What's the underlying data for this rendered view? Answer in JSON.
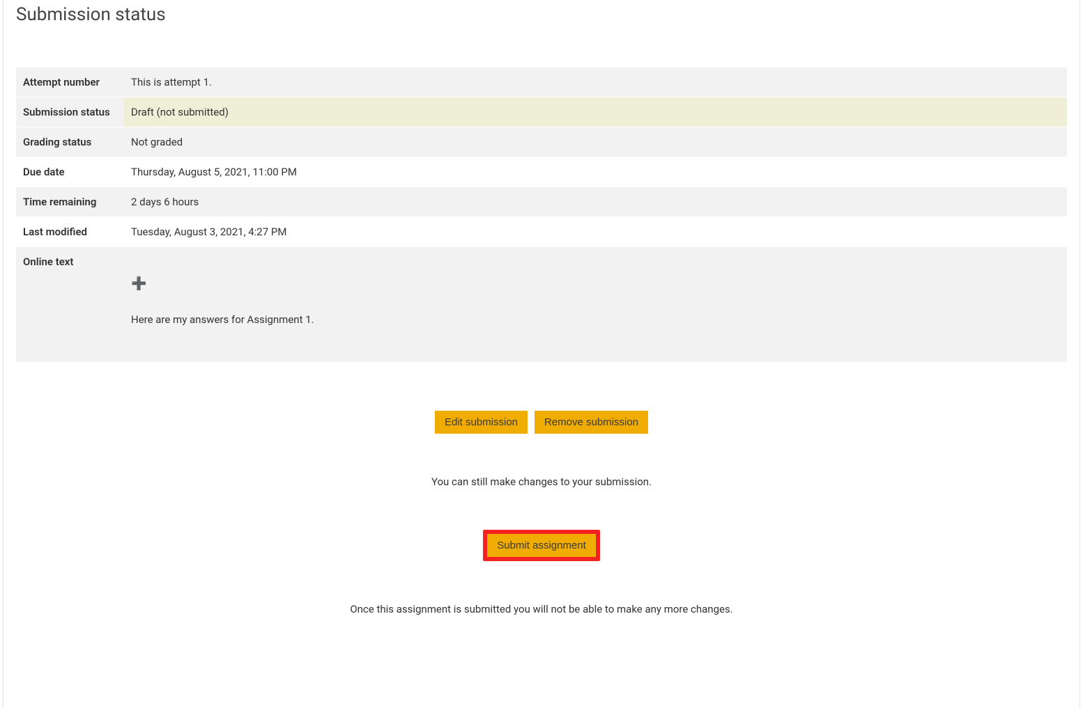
{
  "page": {
    "title": "Submission status"
  },
  "rows": {
    "attempt_number": {
      "label": "Attempt number",
      "value": "This is attempt 1."
    },
    "submission_status": {
      "label": "Submission status",
      "value": "Draft (not submitted)"
    },
    "grading_status": {
      "label": "Grading status",
      "value": "Not graded"
    },
    "due_date": {
      "label": "Due date",
      "value": "Thursday, August 5, 2021, 11:00 PM"
    },
    "time_remaining": {
      "label": "Time remaining",
      "value": "2 days 6 hours"
    },
    "last_modified": {
      "label": "Last modified",
      "value": "Tuesday, August 3, 2021, 4:27 PM"
    },
    "online_text": {
      "label": "Online text",
      "value": "Here are my answers for Assignment 1."
    }
  },
  "buttons": {
    "edit": "Edit submission",
    "remove": "Remove submission",
    "submit": "Submit assignment"
  },
  "notes": {
    "can_change": "You can still make changes to your submission.",
    "final_warning": "Once this assignment is submitted you will not be able to make any more changes."
  }
}
